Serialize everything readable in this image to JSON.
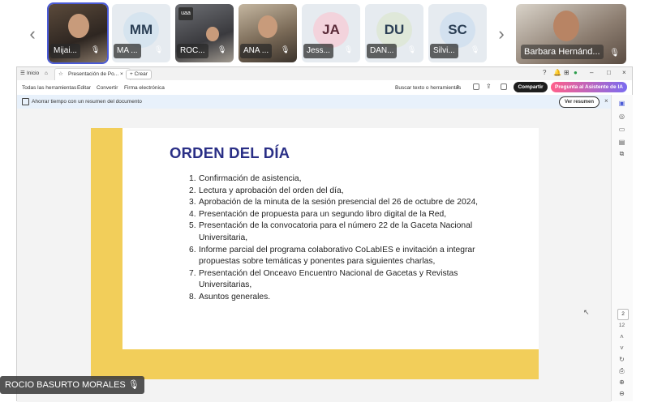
{
  "participants": [
    {
      "name": "Mijai...",
      "initials": "",
      "style": "photo",
      "active": true
    },
    {
      "name": "MA ...",
      "initials": "MM",
      "avatar_color": "#d6e4ef"
    },
    {
      "name": "ROC...",
      "initials": "",
      "style": "photo2",
      "logo": "uaa"
    },
    {
      "name": "ANA ...",
      "initials": "",
      "style": "photo3"
    },
    {
      "name": "Jess...",
      "initials": "JA",
      "avatar_color": "#f3d3dc"
    },
    {
      "name": "DAN...",
      "initials": "DU",
      "avatar_color": "#dfe8d9"
    },
    {
      "name": "Silvi...",
      "initials": "SC",
      "avatar_color": "#d3e1ef"
    }
  ],
  "featured": {
    "name": "Barbara Hernánd..."
  },
  "strip_nav": {
    "prev": "‹",
    "next": "›"
  },
  "tabbar": {
    "home_label": "Inicio",
    "tab_title": "Presentación de Po...",
    "new_tab_label": "+ Crear"
  },
  "toolbar": {
    "all_tools": "Todas las herramientas",
    "edit": "Editar",
    "convert": "Convertir",
    "sign": "Firma electrónica",
    "search": "Buscar texto o herramientas",
    "share": "Compartir",
    "ai": "Pregunta al Asistente de IA"
  },
  "infobar": {
    "message": "Ahorrar tiempo con un resumen del documento",
    "button": "Ver resumen",
    "close": "×"
  },
  "slide": {
    "title": "ORDEN DEL DÍA",
    "items": [
      "Confirmación de asistencia,",
      "Lectura y aprobación del orden del día,",
      "Aprobación de la minuta de la sesión presencial del 26 de octubre de 2024,",
      "Presentación de propuesta para un segundo libro digital de la Red,",
      "Presentación de la convocatoria para el número 22 de la Gaceta Nacional Universitaria,",
      "Informe parcial del programa colaborativo CoLabIES e invitación a integrar propuestas sobre temáticas y ponentes para siguientes charlas,",
      "Presentación del Onceavo Encuentro Nacional de Gacetas y Revistas Universitarias,",
      "Asuntos generales."
    ]
  },
  "pager": {
    "current": "2",
    "total": "12"
  },
  "bottom_participant": {
    "name": "ROCIO BASURTO MORALES"
  }
}
